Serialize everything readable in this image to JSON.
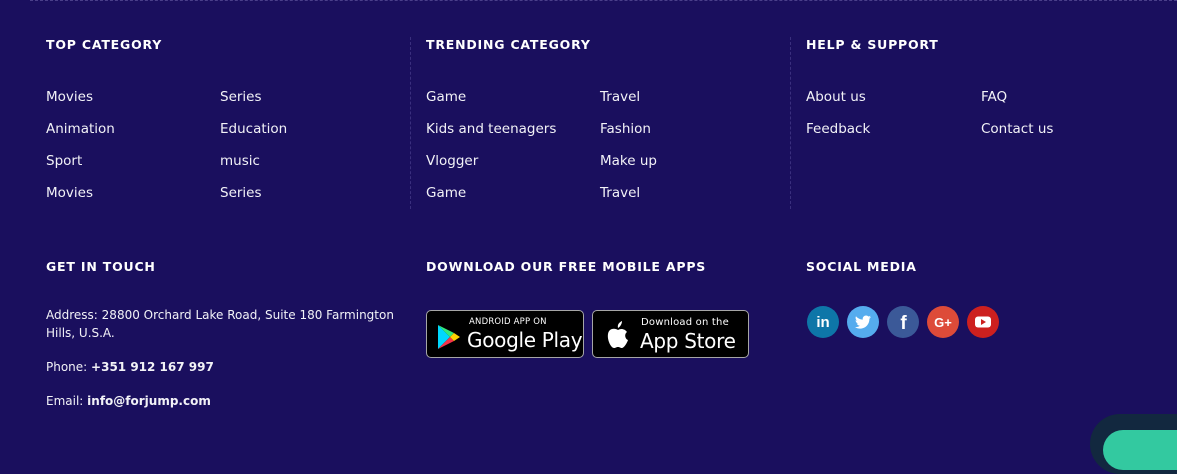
{
  "top_category": {
    "heading": "TOP CATEGORY",
    "left": [
      "Movies",
      "Animation",
      "Sport",
      "Movies"
    ],
    "right": [
      "Series",
      "Education",
      "music",
      "Series"
    ]
  },
  "trending_category": {
    "heading": "TRENDING CATEGORY",
    "left": [
      "Game",
      "Kids and teenagers",
      "Vlogger",
      "Game"
    ],
    "right": [
      "Travel",
      "Fashion",
      "Make up",
      "Travel"
    ]
  },
  "help_support": {
    "heading": "HELP & SUPPORT",
    "left": [
      "About us",
      "Feedback"
    ],
    "right": [
      "FAQ",
      "Contact us"
    ]
  },
  "get_in_touch": {
    "heading": "GET IN TOUCH",
    "address_label": "Address:",
    "address_value": "28800 Orchard Lake Road, Suite 180 Farmington Hills, U.S.A.",
    "phone_label": "Phone:",
    "phone_value": "+351 912 167 997",
    "email_label": "Email:",
    "email_value": "info@forjump.com"
  },
  "apps": {
    "heading": "DOWNLOAD OUR FREE MOBILE APPS",
    "google_small": "ANDROID APP ON",
    "google_big": "Google Play",
    "apple_small": "Download on the",
    "apple_big": "App Store"
  },
  "social": {
    "heading": "SOCIAL MEDIA",
    "items": [
      {
        "name": "linkedin",
        "label": "in",
        "color": "#0e76a8"
      },
      {
        "name": "twitter",
        "label": "",
        "color": "#55acee"
      },
      {
        "name": "facebook",
        "label": "f",
        "color": "#3b5998"
      },
      {
        "name": "google-plus",
        "label": "G+",
        "color": "#dd4b39"
      },
      {
        "name": "youtube",
        "label": "",
        "color": "#cd201f"
      }
    ]
  },
  "colors": {
    "background": "#1a0f5e",
    "text": "#ffffff",
    "chat_accent": "#33c9a0"
  }
}
